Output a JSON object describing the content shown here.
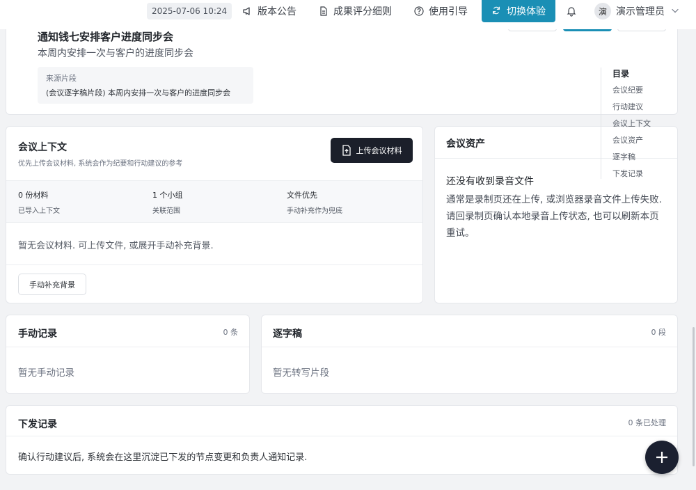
{
  "topbar": {
    "timestamp": "2025-07-06 10:24",
    "release_notes": "版本公告",
    "scoring_rules": "成果评分细则",
    "guide": "使用引导",
    "switch_experience": "切换体验",
    "avatar_char": "演",
    "user_name": "演示管理员"
  },
  "task_card": {
    "title": "通知钱七安排客户进度同步会",
    "subtitle": "本周内安排一次与客户的进度同步会",
    "source_label": "来源片段",
    "source_text": "(会议逐字稿片段) 本周内安排一次与客户的进度同步会"
  },
  "toc": {
    "title": "目录",
    "items": [
      "会议纪要",
      "行动建议",
      "会议上下文",
      "会议资产",
      "逐字稿",
      "下发记录"
    ]
  },
  "context": {
    "title": "会议上下文",
    "subtitle": "优先上传会议材料, 系统会作为纪要和行动建议的参考",
    "upload_label": "上传会议材料",
    "stats": [
      {
        "value": "0 份材料",
        "label": "已导入上下文"
      },
      {
        "value": "1 个小组",
        "label": "关联范围"
      },
      {
        "value": "文件优先",
        "label": "手动补充作为兜底"
      }
    ],
    "empty_text": "暂无会议材料. 可上传文件, 或展开手动补充背景.",
    "manual_button": "手动补充背景"
  },
  "assets": {
    "title": "会议资产",
    "heading": "还没有收到录音文件",
    "body": "通常是录制页还在上传, 或浏览器录音文件上传失败. 请回录制页确认本地录音上传状态, 也可以刷新本页重试。"
  },
  "manual_records": {
    "title": "手动记录",
    "count": "0 条",
    "empty": "暂无手动记录"
  },
  "transcript": {
    "title": "逐字稿",
    "count": "0 段",
    "empty": "暂无转写片段"
  },
  "dispatch": {
    "title": "下发记录",
    "count": "0 条已处理",
    "body": "确认行动建议后, 系统会在这里沉淀已下发的节点变更和负责人通知记录."
  },
  "colors": {
    "accent": "#1a8fb5",
    "dark_button": "#1b1f2a",
    "background": "#f2f3f5"
  }
}
